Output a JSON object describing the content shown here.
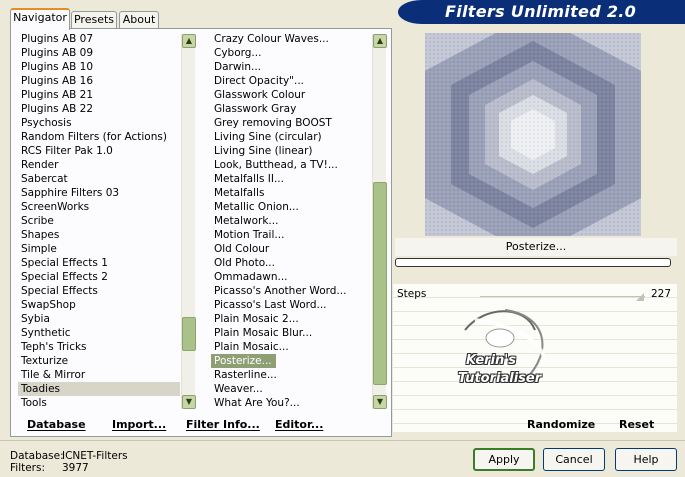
{
  "tabs": [
    {
      "label": "Navigator",
      "active": true
    },
    {
      "label": "Presets",
      "active": false
    },
    {
      "label": "About",
      "active": false
    }
  ],
  "app_title": "Filters Unlimited 2.0",
  "categories": [
    "Plugins AB 07",
    "Plugins AB 09",
    "Plugins AB 10",
    "Plugins AB 16",
    "Plugins AB 21",
    "Plugins AB 22",
    "Psychosis",
    "Random Filters (for Actions)",
    "RCS Filter Pak 1.0",
    "Render",
    "Sabercat",
    "Sapphire Filters 03",
    "ScreenWorks",
    "Scribe",
    "Shapes",
    "Simple",
    "Special Effects 1",
    "Special Effects 2",
    "Special Effects",
    "SwapShop",
    "Sybia",
    "Synthetic",
    "Teph's Tricks",
    "Texturize",
    "Tile & Mirror",
    "Toadies",
    "Tools"
  ],
  "categories_selected_index": 25,
  "filters": [
    "Crazy Colour Waves...",
    "Cyborg...",
    "Darwin...",
    "Direct Opacity\"...",
    "Glasswork Colour",
    "Glasswork Gray",
    "Grey removing BOOST",
    "Living Sine (circular)",
    "Living Sine (linear)",
    "Look, Butthead, a TV!...",
    "Metalfalls II...",
    "Metalfalls",
    "Metallic Onion...",
    "Metalwork...",
    "Motion Trail...",
    "Old Colour",
    "Old Photo...",
    "Ommadawn...",
    "Picasso's Another Word...",
    "Picasso's Last Word...",
    "Plain Mosaic 2...",
    "Plain Mosaic Blur...",
    "Plain Mosaic...",
    "Posterize...",
    "Rasterline...",
    "Weaver...",
    "What Are You?..."
  ],
  "filters_selected_index": 23,
  "list_buttons": {
    "database": "Database",
    "import": "Import...",
    "filter_info": "Filter Info...",
    "editor": "Editor..."
  },
  "current_filter": "Posterize...",
  "progress": 0,
  "parameters": [
    {
      "name": "Steps",
      "value": "227"
    }
  ],
  "watermark": {
    "line1": "Kerin's",
    "line2": "Tutorialiser"
  },
  "right_buttons": {
    "randomize": "Randomize",
    "reset": "Reset"
  },
  "info": {
    "database_label": "Database:",
    "database_value": "ICNET-Filters",
    "filters_label": "Filters:",
    "filters_value": "3977"
  },
  "dialog_buttons": {
    "apply": "Apply",
    "cancel": "Cancel",
    "help": "Help"
  },
  "icons": {
    "scroll_up": "▲",
    "scroll_down": "▼"
  },
  "colors": {
    "banner": "#0a2f78",
    "selection_green": "#8f9f74",
    "scrollbar": "#a9c289",
    "default_button_border": "#3b7c2a",
    "tab_highlight": "#e68b2c"
  }
}
